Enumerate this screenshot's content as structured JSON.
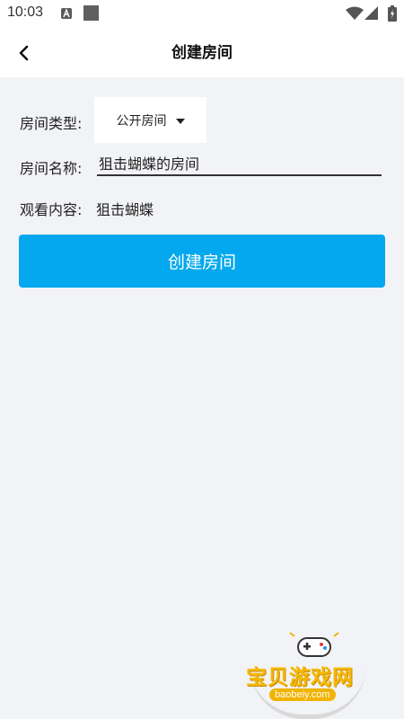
{
  "status_bar": {
    "time": "10:03",
    "icons": [
      "a-notification-icon",
      "square-notification-icon",
      "wifi-icon",
      "signal-icon",
      "battery-icon"
    ]
  },
  "header": {
    "title": "创建房间",
    "back_icon": "back-arrow-icon"
  },
  "form": {
    "room_type": {
      "label": "房间类型:",
      "selected": "公开房间"
    },
    "room_name": {
      "label": "房间名称:",
      "value": "狙击蝴蝶的房间"
    },
    "watch_content": {
      "label": "观看内容:",
      "value": "狙击蝴蝶"
    }
  },
  "create_button": {
    "label": "创建房间",
    "color": "#04a8ee"
  },
  "watermark": {
    "title": "宝贝游戏网",
    "domain": "baobeiy.com"
  },
  "colors": {
    "background": "#f2f3f6",
    "header_bg": "#ffffff",
    "accent": "#04a8ee"
  }
}
